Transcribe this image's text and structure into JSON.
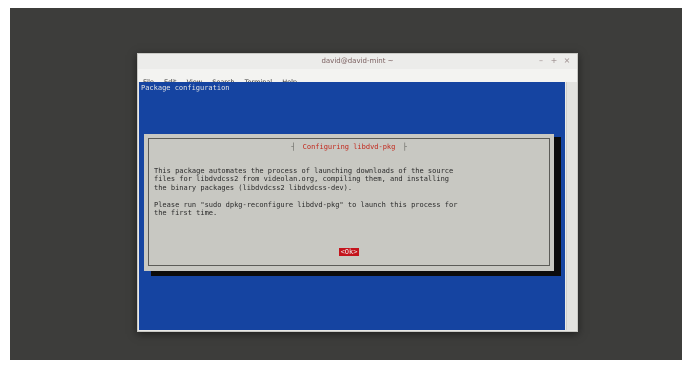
{
  "window": {
    "title": "david@david-mint ~",
    "controls": {
      "minimize": "–",
      "maximize": "+",
      "close": "×"
    }
  },
  "menu": [
    "File",
    "Edit",
    "View",
    "Search",
    "Terminal",
    "Help"
  ],
  "terminal": {
    "header": "Package configuration"
  },
  "dialog": {
    "title": "Configuring libdvd-pkg",
    "line1": "This package automates the process of launching downloads of the source",
    "line2": "files for libdvdcss2 from videolan.org, compiling them, and installing",
    "line3": "the binary packages (libdvdcss2 libdvdcss-dev).",
    "line4": "Please run \"sudo dpkg-reconfigure libdvd-pkg\" to launch this process for",
    "line5": "the first time.",
    "ok_label": "<Ok>"
  },
  "colors": {
    "terminal_bg": "#1544a1",
    "dialog_bg": "#c8c8c2",
    "accent_red": "#c4141c"
  }
}
